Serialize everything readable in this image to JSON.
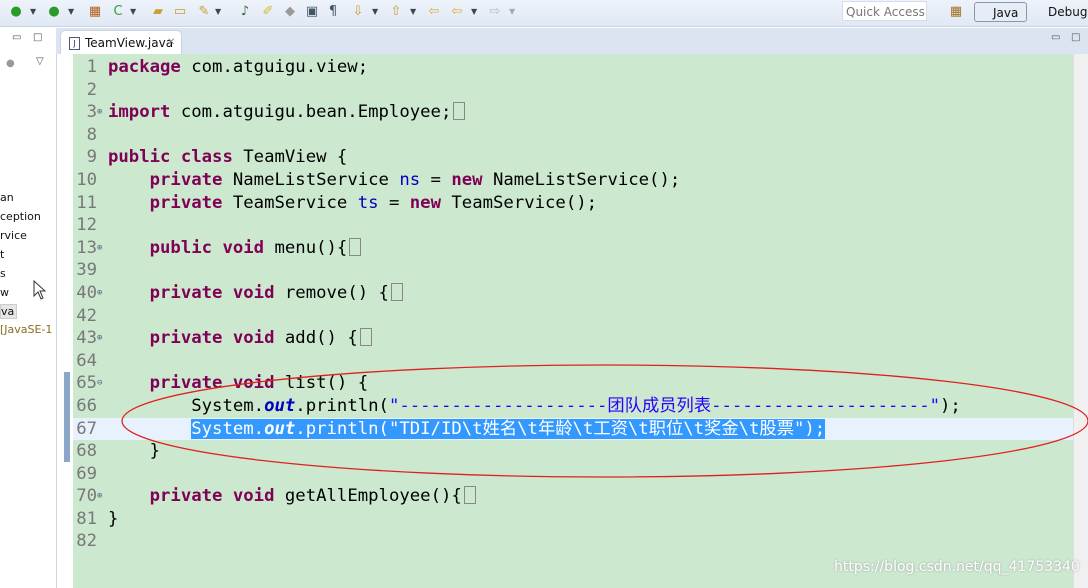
{
  "toolbar": {
    "quick_access_placeholder": "Quick Access",
    "perspectives": [
      {
        "label": "Java",
        "active": true
      },
      {
        "label": "Debug",
        "active": false
      }
    ]
  },
  "editor_tab": {
    "label": "TeamView.java",
    "icon": "java-file-icon",
    "close_icon": "close-icon"
  },
  "left_panel": {
    "items": [
      "an",
      "ception",
      "rvice",
      "t",
      "s",
      "w",
      "va",
      "[JavaSE-1"
    ]
  },
  "colors": {
    "editor_bg": "#cce8cf",
    "keyword": "#7f0055",
    "string": "#2a00ff",
    "field": "#0000c0",
    "selection": "#3399ff",
    "annotation_ellipse": "#e02020"
  },
  "code": {
    "lines": [
      {
        "n": "1",
        "tokens": [
          {
            "t": "package",
            "c": "kw"
          },
          {
            "t": " com.atguigu.view;"
          }
        ]
      },
      {
        "n": "2",
        "tokens": []
      },
      {
        "n": "3",
        "fold": "+",
        "tokens": [
          {
            "t": "import",
            "c": "kw"
          },
          {
            "t": " com.atguigu.bean.Employee;"
          }
        ],
        "collapsed": true
      },
      {
        "n": "8",
        "tokens": []
      },
      {
        "n": "9",
        "tokens": [
          {
            "t": "public",
            "c": "kw"
          },
          {
            "t": " "
          },
          {
            "t": "class",
            "c": "kw"
          },
          {
            "t": " TeamView {"
          }
        ]
      },
      {
        "n": "10",
        "tokens": [
          {
            "t": "    "
          },
          {
            "t": "private",
            "c": "kw"
          },
          {
            "t": " NameListService "
          },
          {
            "t": "ns",
            "c": "fld"
          },
          {
            "t": " = "
          },
          {
            "t": "new",
            "c": "kw"
          },
          {
            "t": " NameListService();"
          }
        ]
      },
      {
        "n": "11",
        "tokens": [
          {
            "t": "    "
          },
          {
            "t": "private",
            "c": "kw"
          },
          {
            "t": " TeamService "
          },
          {
            "t": "ts",
            "c": "fld"
          },
          {
            "t": " = "
          },
          {
            "t": "new",
            "c": "kw"
          },
          {
            "t": " TeamService();"
          }
        ]
      },
      {
        "n": "12",
        "tokens": []
      },
      {
        "n": "13",
        "fold": "+",
        "tokens": [
          {
            "t": "    "
          },
          {
            "t": "public",
            "c": "kw"
          },
          {
            "t": " "
          },
          {
            "t": "void",
            "c": "kw"
          },
          {
            "t": " menu(){"
          }
        ],
        "collapsed": true
      },
      {
        "n": "39",
        "tokens": []
      },
      {
        "n": "40",
        "fold": "+",
        "tokens": [
          {
            "t": "    "
          },
          {
            "t": "private",
            "c": "kw"
          },
          {
            "t": " "
          },
          {
            "t": "void",
            "c": "kw"
          },
          {
            "t": " remove() {"
          }
        ],
        "collapsed": true
      },
      {
        "n": "42",
        "tokens": []
      },
      {
        "n": "43",
        "fold": "+",
        "tokens": [
          {
            "t": "    "
          },
          {
            "t": "private",
            "c": "kw"
          },
          {
            "t": " "
          },
          {
            "t": "void",
            "c": "kw"
          },
          {
            "t": " add() {"
          }
        ],
        "collapsed": true
      },
      {
        "n": "64",
        "tokens": []
      },
      {
        "n": "65",
        "fold": "-",
        "tokens": [
          {
            "t": "    "
          },
          {
            "t": "private",
            "c": "kw"
          },
          {
            "t": " "
          },
          {
            "t": "void",
            "c": "kw"
          },
          {
            "t": " list() {"
          }
        ]
      },
      {
        "n": "66",
        "tokens": [
          {
            "t": "        System."
          },
          {
            "t": "out",
            "c": "sfld"
          },
          {
            "t": ".println("
          },
          {
            "t": "\"--------------------团队成员列表---------------------\"",
            "c": "str"
          },
          {
            "t": ");"
          }
        ]
      },
      {
        "n": "67",
        "current": true,
        "selected": true,
        "tokens": [
          {
            "t": "        "
          },
          {
            "t": "System.",
            "sel": true
          },
          {
            "t": "out",
            "c": "sfld",
            "sel": true
          },
          {
            "t": ".println(",
            "sel": true
          },
          {
            "t": "\"TDI/ID\\t姓名\\t年龄\\t工资\\t职位\\t奖金\\t股票\"",
            "c": "str",
            "sel": true
          },
          {
            "t": ");",
            "sel": true
          }
        ]
      },
      {
        "n": "68",
        "tokens": [
          {
            "t": "    }"
          }
        ]
      },
      {
        "n": "69",
        "tokens": []
      },
      {
        "n": "70",
        "fold": "+",
        "tokens": [
          {
            "t": "    "
          },
          {
            "t": "private",
            "c": "kw"
          },
          {
            "t": " "
          },
          {
            "t": "void",
            "c": "kw"
          },
          {
            "t": " getAllEmployee(){"
          }
        ],
        "collapsed": true
      },
      {
        "n": "81",
        "tokens": [
          {
            "t": "}"
          }
        ]
      },
      {
        "n": "82",
        "tokens": []
      }
    ]
  },
  "watermark": "https://blog.csdn.net/qq_41753340"
}
